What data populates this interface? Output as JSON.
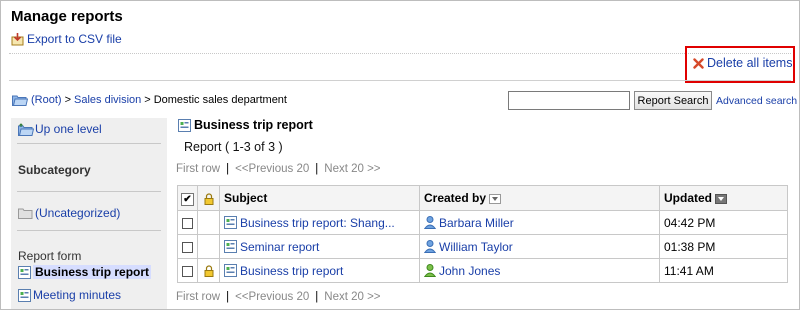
{
  "page": {
    "title": "Manage reports"
  },
  "toolbar": {
    "export_label": "Export to CSV file",
    "delete_label": "Delete all items"
  },
  "breadcrumb": {
    "root": "(Root)",
    "sep": ">",
    "level1": "Sales division",
    "current": "Domestic sales department"
  },
  "search": {
    "value": "",
    "button_label": "Report Search",
    "advanced_label": "Advanced search"
  },
  "sidebar": {
    "up_label": "Up one level",
    "subcategory_heading": "Subcategory",
    "uncategorized_label": "(Uncategorized)",
    "report_form_heading": "Report form",
    "forms": [
      {
        "label": "Business trip report",
        "selected": true
      },
      {
        "label": "Meeting minutes",
        "selected": false
      }
    ]
  },
  "main": {
    "report_title": "Business trip report",
    "count_label": "Report ( 1-3 of 3 )",
    "pager": {
      "first": "First row",
      "sep": "|",
      "prev": "<<Previous 20",
      "next": "Next 20 >>"
    },
    "table": {
      "headers": {
        "check": "✔",
        "subject": "Subject",
        "created_by": "Created by",
        "updated": "Updated"
      },
      "rows": [
        {
          "locked": false,
          "subject": "Business trip report: Shang...",
          "creator": "Barbara Miller",
          "creator_icon": "user-blue-icon",
          "updated": "04:42 PM"
        },
        {
          "locked": false,
          "subject": "Seminar report",
          "creator": "William Taylor",
          "creator_icon": "user-blue-icon",
          "updated": "01:38 PM"
        },
        {
          "locked": true,
          "subject": "Business trip report",
          "creator": "John Jones",
          "creator_icon": "user-green-icon",
          "updated": "11:41 AM"
        }
      ]
    }
  },
  "colors": {
    "link": "#1a3fa8",
    "highlight_box": "#e00000",
    "selected_bg": "#d6ddff",
    "sidebar_bg": "#efefef"
  }
}
